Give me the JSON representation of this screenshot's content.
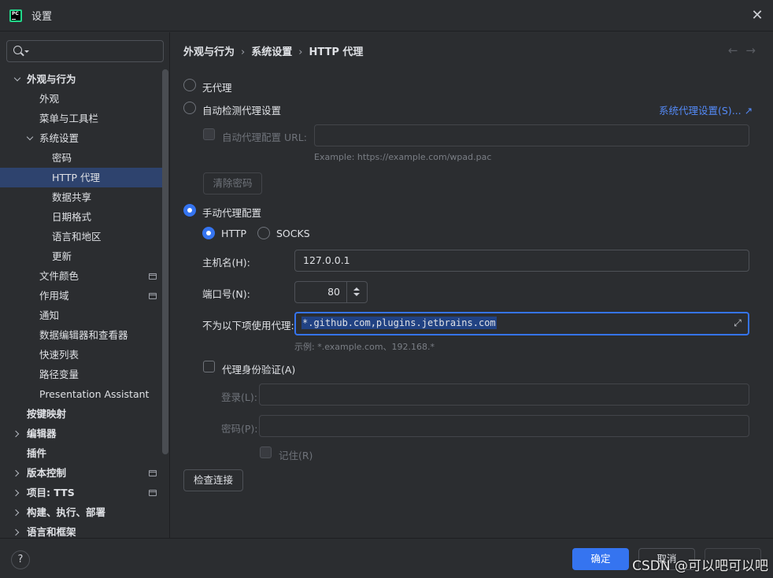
{
  "window": {
    "title": "设置",
    "app_icon_text": "PC"
  },
  "search": {
    "placeholder": ""
  },
  "sidebar": {
    "items": [
      {
        "label": "外观与行为",
        "level": 0,
        "chevron": "down",
        "bold": true
      },
      {
        "label": "外观",
        "level": 1
      },
      {
        "label": "菜单与工具栏",
        "level": 1
      },
      {
        "label": "系统设置",
        "level": 1,
        "chevron": "down"
      },
      {
        "label": "密码",
        "level": 2
      },
      {
        "label": "HTTP 代理",
        "level": 2,
        "selected": true
      },
      {
        "label": "数据共享",
        "level": 2
      },
      {
        "label": "日期格式",
        "level": 2
      },
      {
        "label": "语言和地区",
        "level": 2
      },
      {
        "label": "更新",
        "level": 2
      },
      {
        "label": "文件颜色",
        "level": 1,
        "project_icon": true
      },
      {
        "label": "作用域",
        "level": 1,
        "project_icon": true
      },
      {
        "label": "通知",
        "level": 1
      },
      {
        "label": "数据编辑器和查看器",
        "level": 1
      },
      {
        "label": "快速列表",
        "level": 1
      },
      {
        "label": "路径变量",
        "level": 1
      },
      {
        "label": "Presentation Assistant",
        "level": 1
      },
      {
        "label": "按键映射",
        "level": 0,
        "bold": true
      },
      {
        "label": "编辑器",
        "level": 0,
        "chevron": "right",
        "bold": true
      },
      {
        "label": "插件",
        "level": 0,
        "bold": true
      },
      {
        "label": "版本控制",
        "level": 0,
        "chevron": "right",
        "bold": true,
        "project_icon": true
      },
      {
        "label": "项目: TTS",
        "level": 0,
        "chevron": "right",
        "bold": true,
        "project_icon": true
      },
      {
        "label": "构建、执行、部署",
        "level": 0,
        "chevron": "right",
        "bold": true
      },
      {
        "label": "语言和框架",
        "level": 0,
        "chevron": "right",
        "bold": true
      }
    ]
  },
  "breadcrumb": {
    "part1": "外观与行为",
    "part2": "系统设置",
    "part3": "HTTP 代理",
    "separator": "›"
  },
  "nav": {
    "back": "←",
    "forward": "→"
  },
  "proxy": {
    "no_proxy": "无代理",
    "auto_detect": "自动检测代理设置",
    "system_proxy_link": "系统代理设置(S)... ↗",
    "auto_config_url_label": "自动代理配置 URL:",
    "auto_config_url_value": "",
    "auto_config_hint": "Example: https://example.com/wpad.pac",
    "clear_password": "清除密码",
    "manual": "手动代理配置",
    "http": "HTTP",
    "socks": "SOCKS",
    "host_label": "主机名(H):",
    "host_value": "127.0.0.1",
    "port_label": "端口号(N):",
    "port_value": "80",
    "no_proxy_for_label": "不为以下项使用代理:",
    "no_proxy_for_value": "*.github.com,plugins.jetbrains.com",
    "no_proxy_for_hint": "示例: *.example.com、192.168.*",
    "auth_label": "代理身份验证(A)",
    "login_label": "登录(L):",
    "login_value": "",
    "password_label": "密码(P):",
    "password_value": "",
    "remember_label": "记住(R)",
    "check_connection": "检查连接",
    "selected_mode": "manual",
    "selected_protocol": "HTTP"
  },
  "footer": {
    "help": "?",
    "ok": "确定",
    "cancel": "取消",
    "apply": "",
    "watermark": "CSDN @可以吧可以吧"
  },
  "colors": {
    "accent": "#3574f0",
    "selection": "#2e436e",
    "link": "#548af7"
  }
}
